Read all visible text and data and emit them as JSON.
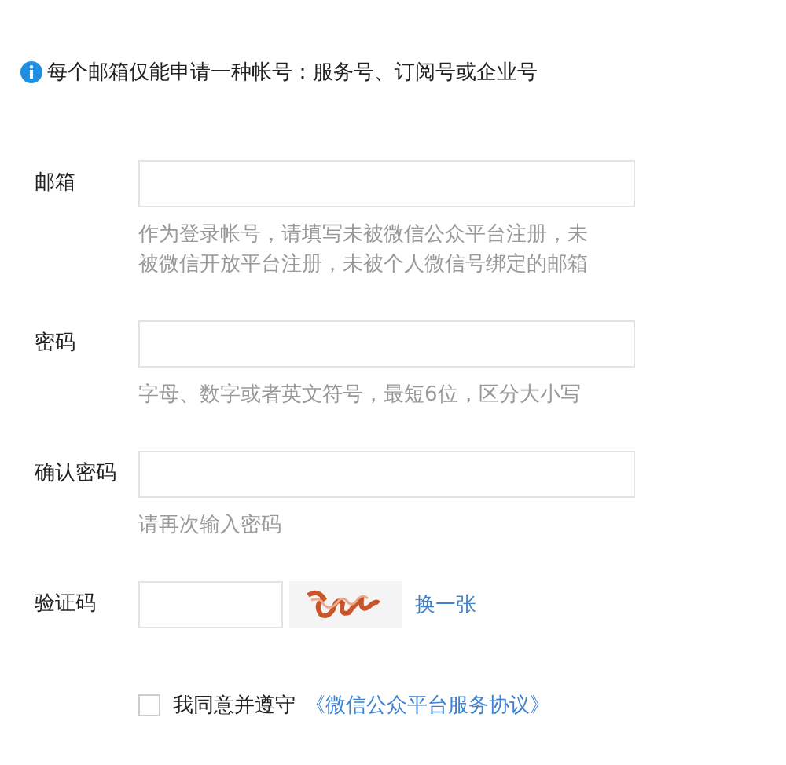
{
  "notice": {
    "text": "每个邮箱仅能申请一种帐号：服务号、订阅号或企业号"
  },
  "fields": [
    {
      "kind": "text",
      "label": "邮箱",
      "hint": [
        "作为登录帐号，请填写未被微信公众平台注册，未",
        "被微信开放平台注册，未被个人微信号绑定的邮箱"
      ]
    },
    {
      "kind": "text",
      "label": "密码",
      "hint": [
        "字母、数字或者英文符号，最短6位，区分大小写"
      ]
    },
    {
      "kind": "text",
      "label": "确认密码",
      "hint": [
        "请再次输入密码"
      ]
    },
    {
      "kind": "captcha",
      "label": "验证码",
      "refresh_link": "换一张"
    }
  ],
  "agreement": {
    "checked": false,
    "text": "我同意并遵守",
    "link": "《微信公众平台服务协议》"
  }
}
